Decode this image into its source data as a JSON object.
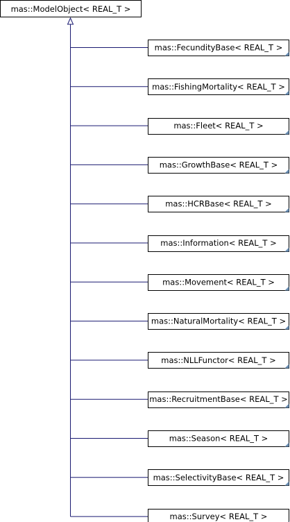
{
  "diagram": {
    "root": {
      "label": "mas::ModelObject< REAL_T >"
    },
    "children": [
      {
        "label": "mas::FecundityBase< REAL_T >"
      },
      {
        "label": "mas::FishingMortality< REAL_T >"
      },
      {
        "label": "mas::Fleet< REAL_T >"
      },
      {
        "label": "mas::GrowthBase< REAL_T >"
      },
      {
        "label": "mas::HCRBase< REAL_T >"
      },
      {
        "label": "mas::Information< REAL_T >"
      },
      {
        "label": "mas::Movement< REAL_T >"
      },
      {
        "label": "mas::NaturalMortality< REAL_T >"
      },
      {
        "label": "mas::NLLFunctor< REAL_T >"
      },
      {
        "label": "mas::RecruitmentBase< REAL_T >"
      },
      {
        "label": "mas::Season< REAL_T >"
      },
      {
        "label": "mas::SelectivityBase< REAL_T >"
      },
      {
        "label": "mas::Survey< REAL_T >"
      }
    ],
    "colors": {
      "edge": "#191970",
      "node_border": "#000000",
      "root_fill": "#ffffff",
      "child_fill": "#ffffff",
      "corner_marker": "#6b8fb5"
    }
  }
}
